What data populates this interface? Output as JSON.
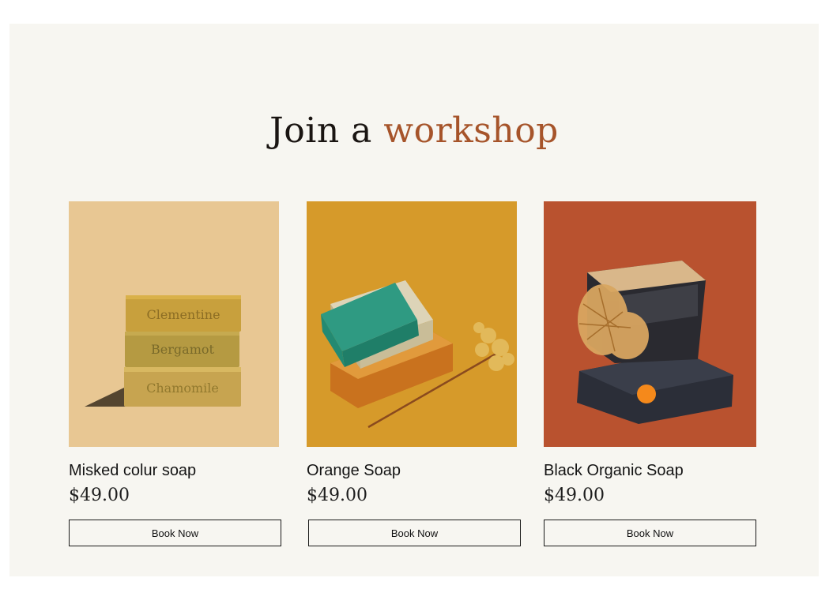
{
  "heading": {
    "part1": "Join a",
    "part2": "workshop"
  },
  "products": [
    {
      "name": "Misked colur soap",
      "price": "$49.00",
      "button": "Book Now",
      "bar_labels": [
        "Clementine",
        "Bergamot",
        "Chamomile"
      ],
      "bg_color": "#e8c793"
    },
    {
      "name": "Orange Soap",
      "price": "$49.00",
      "button": "Book Now",
      "bg_color": "#d69a2a"
    },
    {
      "name": "Black Organic Soap",
      "price": "$49.00",
      "button": "Book Now",
      "bg_color": "#b9522f"
    }
  ],
  "colors": {
    "accent": "#a6542a",
    "panel": "#f7f6f1",
    "cursor_dot": "#f5891b"
  }
}
